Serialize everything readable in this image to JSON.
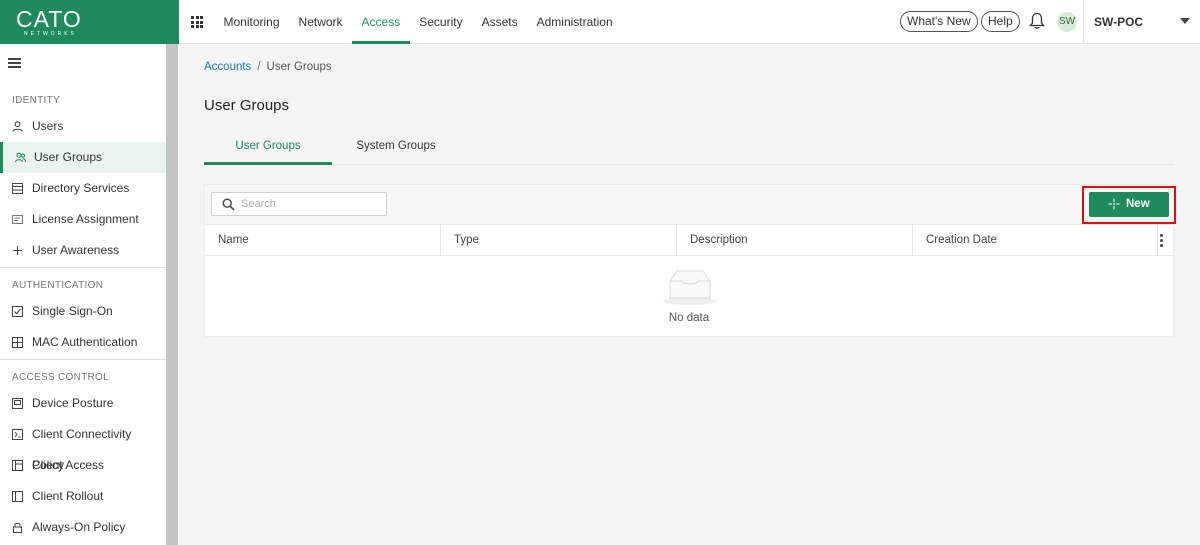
{
  "logo": {
    "main": "CATO",
    "sub": "NETWORKS"
  },
  "nav": {
    "items": [
      "Monitoring",
      "Network",
      "Access",
      "Security",
      "Assets",
      "Administration"
    ],
    "active": "Access"
  },
  "header": {
    "whats_new": "What's New",
    "help": "Help",
    "avatar_initials": "SW",
    "account_name": "SW-POC"
  },
  "sidebar": {
    "identity_title": "IDENTITY",
    "identity": [
      "Users",
      "User Groups",
      "Directory Services",
      "License Assignment",
      "User Awareness"
    ],
    "authentication_title": "AUTHENTICATION",
    "authentication": [
      "Single Sign-On",
      "MAC Authentication"
    ],
    "access_control_title": "ACCESS CONTROL",
    "access_control": [
      "Device Posture",
      "Client Connectivity Policy",
      "Client Access",
      "Client Rollout",
      "Always-On Policy"
    ],
    "active": "User Groups"
  },
  "breadcrumb": {
    "root": "Accounts",
    "current": "User Groups"
  },
  "page": {
    "title": "User Groups"
  },
  "tabs": [
    "User Groups",
    "System Groups"
  ],
  "toolbar": {
    "search_placeholder": "Search",
    "search_value": "",
    "new_label": "New"
  },
  "table": {
    "columns": [
      "Name",
      "Type",
      "Description",
      "Creation Date"
    ],
    "empty_text": "No data"
  },
  "colors": {
    "brand": "#1f8a5b",
    "highlight": "#e01010",
    "link": "#1a73b8"
  },
  "icons": {
    "apps": "apps-grid-icon",
    "bell": "bell-icon",
    "hamburger": "hamburger-menu-icon",
    "search": "search-icon",
    "new": "sparkle-add-icon",
    "kebab": "kebab-menu-icon",
    "empty": "empty-inbox-icon"
  }
}
